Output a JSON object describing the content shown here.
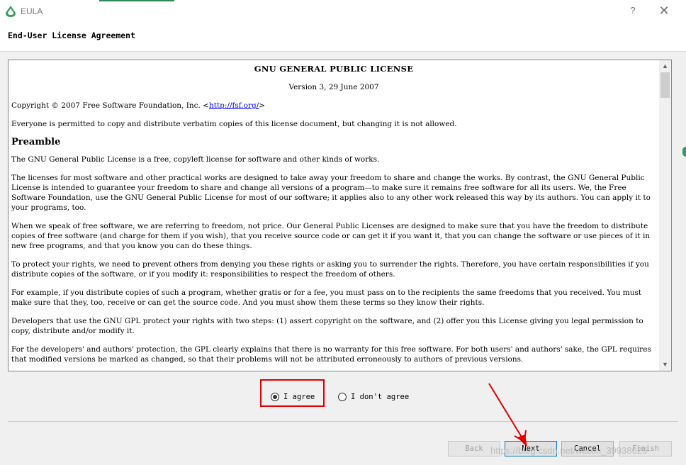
{
  "window": {
    "title": "EULA",
    "help_glyph": "?",
    "close_glyph": "✕"
  },
  "page": {
    "title": "End-User License Agreement"
  },
  "license": {
    "title": "GNU GENERAL PUBLIC LICENSE",
    "version": "Version 3, 29 June 2007",
    "copyright_prefix": "Copyright © 2007 Free Software Foundation, Inc. <",
    "copyright_link": "http://fsf.org/",
    "copyright_suffix": ">",
    "everyone": "Everyone is permitted to copy and distribute verbatim copies of this license document, but changing it is not allowed.",
    "preamble_heading": "Preamble",
    "paragraphs": [
      "The GNU General Public License is a free, copyleft license for software and other kinds of works.",
      "The licenses for most software and other practical works are designed to take away your freedom to share and change the works. By contrast, the GNU General Public License is intended to guarantee your freedom to share and change all versions of a program—to make sure it remains free software for all its users. We, the Free Software Foundation, use the GNU General Public License for most of our software; it applies also to any other work released this way by its authors. You can apply it to your programs, too.",
      "When we speak of free software, we are referring to freedom, not price. Our General Public Licenses are designed to make sure that you have the freedom to distribute copies of free software (and charge for them if you wish), that you receive source code or can get it if you want it, that you can change the software or use pieces of it in new free programs, and that you know you can do these things.",
      "To protect your rights, we need to prevent others from denying you these rights or asking you to surrender the rights. Therefore, you have certain responsibilities if you distribute copies of the software, or if you modify it: responsibilities to respect the freedom of others.",
      "For example, if you distribute copies of such a program, whether gratis or for a fee, you must pass on to the recipients the same freedoms that you received. You must make sure that they, too, receive or can get the source code. And you must show them these terms so they know their rights.",
      "Developers that use the GNU GPL protect your rights with two steps: (1) assert copyright on the software, and (2) offer you this License giving you legal permission to copy, distribute and/or modify it.",
      "For the developers' and authors' protection, the GPL clearly explains that there is no warranty for this free software. For both users' and authors' sake, the GPL requires that modified versions be marked as changed, so that their problems will not be attributed erroneously to authors of previous versions."
    ]
  },
  "agreement": {
    "agree_label": "I agree",
    "disagree_label": "I don't agree",
    "selected": "I agree"
  },
  "buttons": {
    "back": "Back",
    "next": "Next",
    "cancel": "Cancel",
    "finish": "Finish"
  },
  "watermark": "https://blog.csdn.net/weixin_39938626",
  "colors": {
    "highlight": "#e00000",
    "annotation_arrow": "#e00000",
    "app_icon": "#2e8b57"
  }
}
